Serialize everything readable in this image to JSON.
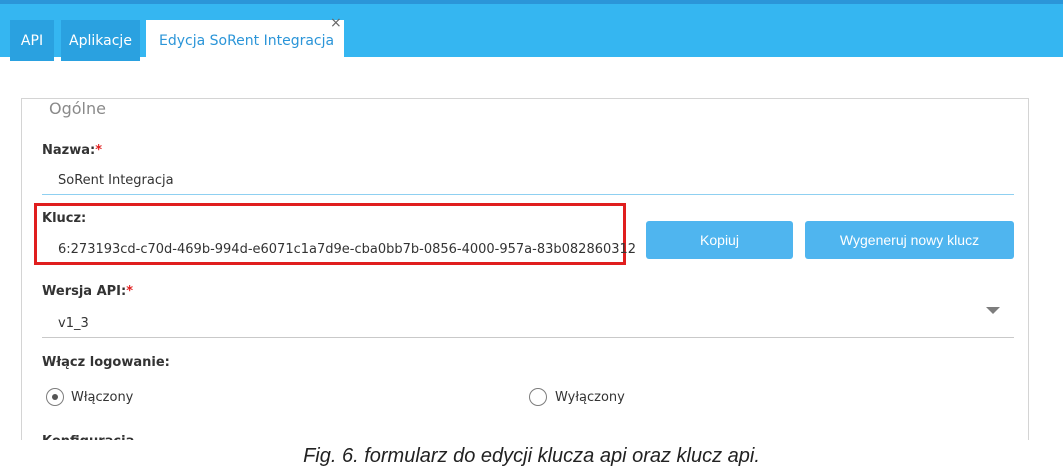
{
  "tabs": [
    {
      "label": "API"
    },
    {
      "label": "Aplikacje"
    },
    {
      "label": "Edycja SoRent Integracja",
      "close_glyph": "×"
    }
  ],
  "form": {
    "legend": "Ogólne",
    "required_mark": "*",
    "name": {
      "label": "Nazwa:",
      "value": "SoRent Integracja"
    },
    "key": {
      "label": "Klucz:",
      "value": "6:273193cd-c70d-469b-994d-e6071c1a7d9e-cba0bb7b-0856-4000-957a-83b082860312"
    },
    "buttons": {
      "copy": "Kopiuj",
      "regenerate": "Wygeneruj nowy klucz"
    },
    "api_version": {
      "label": "Wersja API:",
      "value": "v1_3"
    },
    "logging": {
      "label": "Włącz logowanie:",
      "options": [
        "Włączony",
        "Wyłączony"
      ],
      "selected": "Włączony"
    },
    "cut_label": "Konfiguracja"
  },
  "caption": "Fig. 6. formularz do edycji klucza api oraz klucz api.",
  "colors": {
    "tabbar": "#35b6f1",
    "accent": "#4fb5ef",
    "highlight": "#e01e1e",
    "required": "#e02020"
  }
}
